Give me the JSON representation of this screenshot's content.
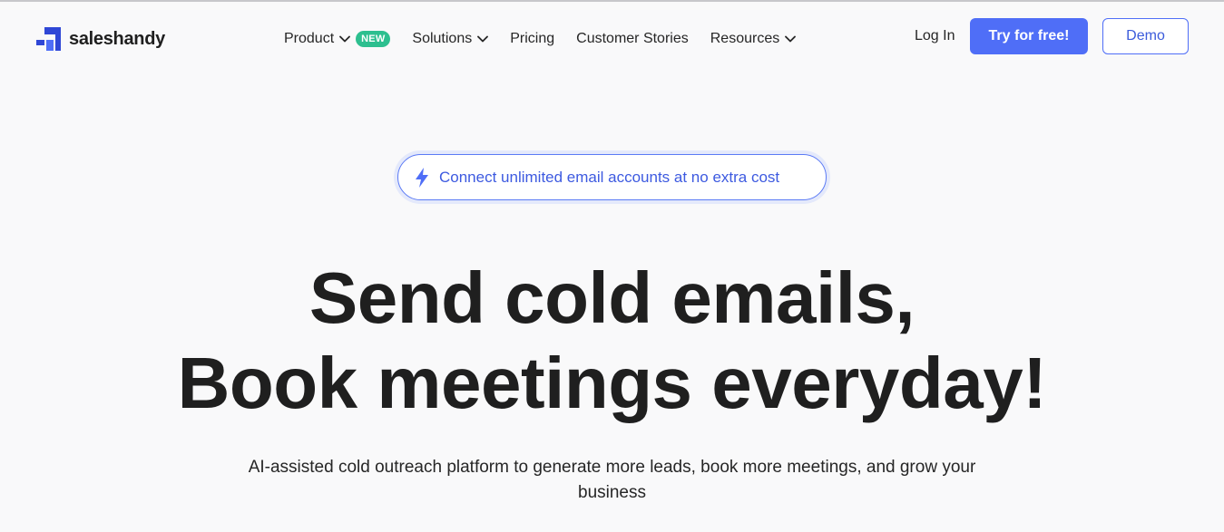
{
  "brand": {
    "name": "saleshandy",
    "color": "#2f47d6"
  },
  "nav": {
    "items": [
      {
        "label": "Product",
        "has_dropdown": true,
        "badge": "NEW"
      },
      {
        "label": "Solutions",
        "has_dropdown": true
      },
      {
        "label": "Pricing",
        "has_dropdown": false
      },
      {
        "label": "Customer Stories",
        "has_dropdown": false
      },
      {
        "label": "Resources",
        "has_dropdown": true
      }
    ]
  },
  "actions": {
    "login_label": "Log In",
    "try_label": "Try for free!",
    "demo_label": "Demo"
  },
  "hero": {
    "announcement": "Connect unlimited email accounts at no extra cost",
    "headline_line1": "Send cold emails,",
    "headline_line2": "Book meetings everyday!",
    "subheadline": "AI-assisted cold outreach platform to generate more leads, book more meetings, and grow your business"
  },
  "colors": {
    "primary": "#4f6ef7",
    "badge_green": "#2dbf8f",
    "background": "#f9f9fa"
  }
}
